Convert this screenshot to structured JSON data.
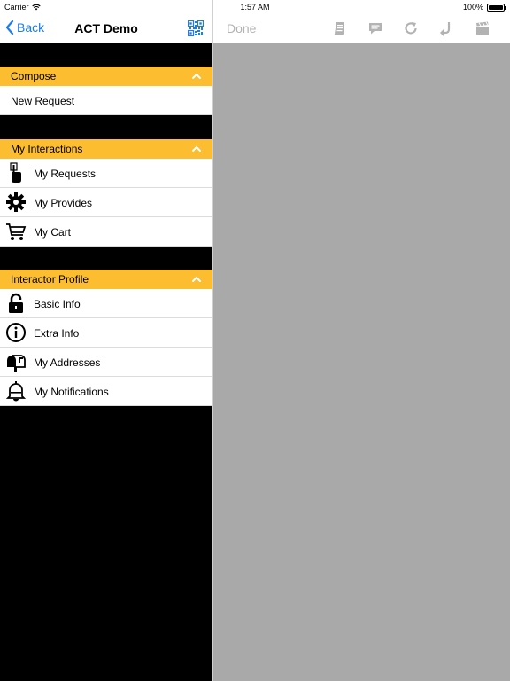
{
  "status_bar": {
    "carrier": "Carrier",
    "time": "1:57 AM",
    "battery": "100%"
  },
  "left_nav": {
    "back_label": "Back",
    "title": "ACT Demo"
  },
  "right_nav": {
    "done_label": "Done"
  },
  "sections": {
    "compose": {
      "header": "Compose",
      "items": [
        {
          "label": "New Request"
        }
      ]
    },
    "my_interactions": {
      "header": "My Interactions",
      "items": [
        {
          "label": "My Requests",
          "icon": "hand-pointer-icon"
        },
        {
          "label": "My Provides",
          "icon": "gear-icon"
        },
        {
          "label": "My Cart",
          "icon": "cart-icon"
        }
      ]
    },
    "interactor_profile": {
      "header": "Interactor Profile",
      "items": [
        {
          "label": "Basic Info",
          "icon": "lock-icon"
        },
        {
          "label": "Extra Info",
          "icon": "info-icon"
        },
        {
          "label": "My Addresses",
          "icon": "mailbox-icon"
        },
        {
          "label": "My Notifications",
          "icon": "bell-icon"
        }
      ]
    }
  },
  "colors": {
    "accent": "#fcbd30",
    "link": "#1a7bf2",
    "detail_bg": "#a9a9a9"
  }
}
